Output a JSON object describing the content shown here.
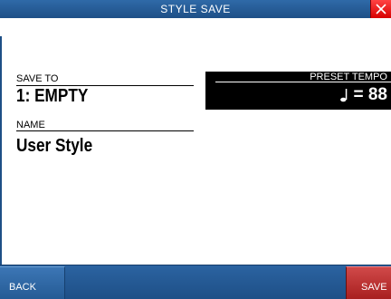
{
  "window": {
    "title": "STYLE SAVE",
    "close_icon": "close-icon"
  },
  "save_to": {
    "label": "SAVE TO",
    "value": "1: EMPTY"
  },
  "name": {
    "label": "NAME",
    "value": "User Style"
  },
  "preset_tempo": {
    "label": "PRESET TEMPO",
    "value": "= 88",
    "note_icon": "quarter-note-icon"
  },
  "footer": {
    "back_label": "BACK",
    "save_label": "SAVE"
  },
  "colors": {
    "title_bar": "#1e4f86",
    "close_button": "#e00000",
    "save_button": "#b72a2a",
    "tempo_panel": "#000000"
  }
}
